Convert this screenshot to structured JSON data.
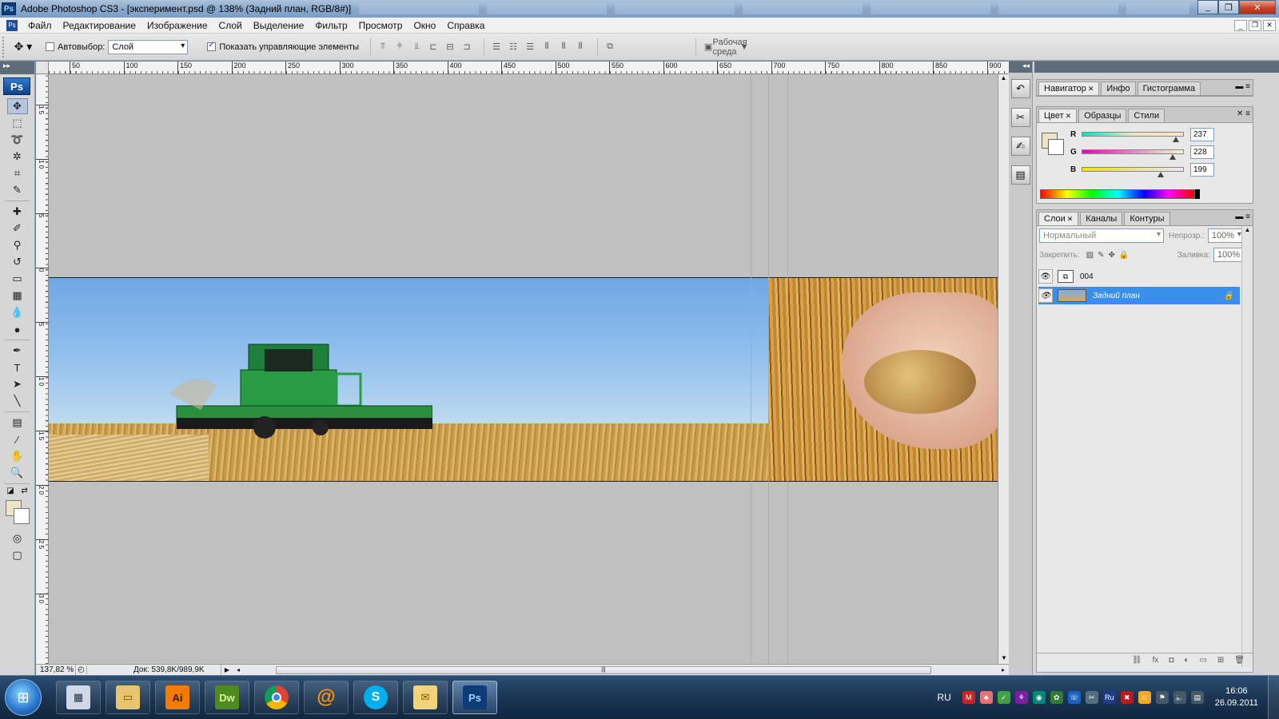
{
  "window": {
    "title": "Adobe Photoshop CS3 - [эксперимент.psd @ 138% (Задний план, RGB/8#)]",
    "app_badge": "Ps",
    "controls": [
      "_",
      "❐",
      "✕"
    ]
  },
  "menubar": {
    "items": [
      "Файл",
      "Редактирование",
      "Изображение",
      "Слой",
      "Выделение",
      "Фильтр",
      "Просмотр",
      "Окно",
      "Справка"
    ],
    "mdi_controls": [
      "_",
      "❐",
      "✕"
    ]
  },
  "options": {
    "autoselect_label": "Автовыбор:",
    "autoselect_checked": false,
    "autoselect_value": "Слой",
    "show_controls_label": "Показать управляющие элементы",
    "show_controls_checked": true,
    "workspace_label": "Рабочая среда"
  },
  "toolbox": {
    "badge": "Ps",
    "tools": [
      {
        "name": "move-tool-icon",
        "glyph": "✥"
      },
      {
        "name": "marquee-tool-icon",
        "glyph": "⬚"
      },
      {
        "name": "lasso-tool-icon",
        "glyph": "➰"
      },
      {
        "name": "magic-wand-tool-icon",
        "glyph": "✲"
      },
      {
        "name": "crop-tool-icon",
        "glyph": "⌗"
      },
      {
        "name": "slice-tool-icon",
        "glyph": "✎"
      },
      {
        "name": "healing-brush-tool-icon",
        "glyph": "✚"
      },
      {
        "name": "brush-tool-icon",
        "glyph": "✐"
      },
      {
        "name": "clone-stamp-tool-icon",
        "glyph": "⚲"
      },
      {
        "name": "history-brush-tool-icon",
        "glyph": "↺"
      },
      {
        "name": "eraser-tool-icon",
        "glyph": "▭"
      },
      {
        "name": "gradient-tool-icon",
        "glyph": "▦"
      },
      {
        "name": "blur-tool-icon",
        "glyph": "💧"
      },
      {
        "name": "dodge-tool-icon",
        "glyph": "●"
      },
      {
        "name": "pen-tool-icon",
        "glyph": "✒"
      },
      {
        "name": "type-tool-icon",
        "glyph": "T"
      },
      {
        "name": "path-selection-tool-icon",
        "glyph": "➤"
      },
      {
        "name": "line-tool-icon",
        "glyph": "╲"
      },
      {
        "name": "notes-tool-icon",
        "glyph": "▤"
      },
      {
        "name": "eyedropper-tool-icon",
        "glyph": "⁄"
      },
      {
        "name": "hand-tool-icon",
        "glyph": "✋"
      },
      {
        "name": "zoom-tool-icon",
        "glyph": "🔍"
      }
    ],
    "extra": [
      {
        "name": "quick-mask-icon",
        "glyph": "◎"
      },
      {
        "name": "screen-mode-icon",
        "glyph": "▢"
      }
    ]
  },
  "rulers": {
    "top": [
      "50",
      "100",
      "150",
      "200",
      "250",
      "300",
      "350",
      "400",
      "450",
      "500",
      "550",
      "600",
      "650",
      "700",
      "750",
      "800",
      "850",
      "900"
    ],
    "left": [
      "1 5",
      "1 0",
      "5",
      "0",
      "5",
      "1 0",
      "1 5",
      "2 0",
      "2 5",
      "3 0"
    ]
  },
  "statusbar": {
    "zoom": "137,82 %",
    "doc_info": "Док: 539,8K/989,9K"
  },
  "panels": {
    "group1_tabs": [
      "Навигатор",
      "Инфо",
      "Гистограмма"
    ],
    "group2_tabs": [
      "Цвет",
      "Образцы",
      "Стили"
    ],
    "group3_tabs": [
      "Слои",
      "Каналы",
      "Контуры"
    ],
    "color": {
      "foreground": "#EDE4C7",
      "channels": [
        {
          "label": "R",
          "value": "237"
        },
        {
          "label": "G",
          "value": "228"
        },
        {
          "label": "B",
          "value": "199"
        }
      ]
    },
    "layers": {
      "blend_mode": "Нормальный",
      "opacity_label": "Непрозр.:",
      "opacity_value": "100%",
      "lock_label": "Закрепить:",
      "fill_label": "Заливка:",
      "fill_value": "100%",
      "items": [
        {
          "name": "004",
          "selected": false,
          "locked": false
        },
        {
          "name": "Задний план",
          "selected": true,
          "locked": true
        }
      ]
    }
  },
  "taskbar": {
    "apps": [
      "calculator",
      "explorer",
      "Ai",
      "Dw",
      "chrome",
      "mail-agent",
      "skype",
      "outlook",
      "Ps"
    ],
    "active_app": "Ps",
    "language": "RU",
    "time": "16:06",
    "date": "26.09.2011"
  },
  "colors": {
    "accent": "#3A8FE8",
    "canvas_bg": "#C0C0C0",
    "guide": "#36D6E6"
  }
}
